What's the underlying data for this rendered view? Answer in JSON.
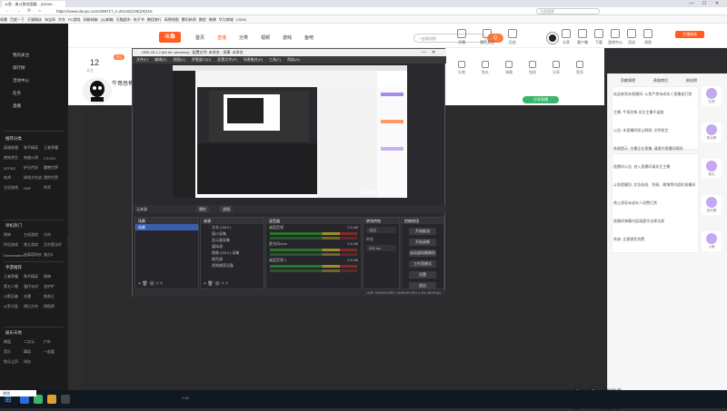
{
  "browser": {
    "tab_title": "斗鱼 - 来斗鱼的国服... [2D0M...",
    "url": "https://www.douyu.com/29871?_t=20142(226(29)116",
    "search_placeholder": "点此搜索",
    "bookmarks": [
      "收藏",
      "百度一下",
      "天猫精选",
      "淘宝网",
      "京东",
      "PC游戏",
      "网易邮箱",
      "QQ邮箱",
      "天猫超市",
      "电子书",
      "携程旅行",
      "高德地图",
      "腾讯新闻",
      "携程",
      "微博",
      "华为商城",
      "CSDN"
    ],
    "nav_back": "←",
    "nav_forward": "→",
    "nav_refresh": "⟳",
    "nav_home": "⌂",
    "win_min": "—",
    "win_max": "☐",
    "win_close": "✕"
  },
  "douyu_header": {
    "logo": "斗鱼",
    "nav": [
      "首页",
      "直播",
      "分类",
      "视频",
      "游戏",
      "鱼吧"
    ],
    "active_nav": "直播",
    "search_placeholder": "一起看电影",
    "search_button": "Q",
    "header_icons": [
      "开播",
      "我的关注",
      "历史",
      "分享",
      "客户端",
      "下载",
      "游戏中心",
      "活动",
      "消息"
    ],
    "vip_button": "开通贵族"
  },
  "sidebar": {
    "top_items": [
      "我的关注",
      "排行榜",
      "活动中心",
      "任务"
    ],
    "live_label": "直播",
    "section1_title": "推荐分类",
    "section1_items": [
      "英雄联盟",
      "和平精英",
      "王者荣耀",
      "绝地求生",
      "穿越火线",
      "CS:GO",
      "DOTA2",
      "炉石传说",
      "魔兽世界",
      "吃鸡",
      "球球大作战",
      "我的世界",
      "主机游戏",
      "DNF",
      "传奇"
    ],
    "section2_title": "单机热门",
    "section2_items": [
      "原神",
      "主机游戏",
      "方舟",
      "怀旧游戏",
      "独立游戏",
      "艾尔登法环",
      "Dreamcatcher",
      "逃离塔科夫",
      "鬼泣5"
    ],
    "section3_title": "手游推荐",
    "section3_items": [
      "王者荣耀",
      "和平精英",
      "原神",
      "第五人格",
      "蛋仔派对",
      "金铲铲",
      "火影忍者",
      "光遇",
      "航海王",
      "斗罗大陆",
      "明日方舟",
      "阴阳师"
    ],
    "section4_title": "娱乐天地",
    "section4_items": [
      "颜值",
      "二次元",
      "户外",
      "音乐",
      "舞蹈",
      "一起看",
      "鱼乐之声",
      "科技"
    ],
    "bottom_btn1": "开播",
    "bottom_btn2": "我的关注"
  },
  "streamer": {
    "follower_count": "12",
    "follower_label": "关注",
    "name": "牛哥恐怖",
    "share_button": "分享直播",
    "toolbar": [
      "礼物",
      "鱼丸",
      "弹幕",
      "钻粉",
      "分享",
      "更多",
      "客户端",
      "主播",
      "设置"
    ]
  },
  "obs": {
    "title": "OBS 28.1.2 (64-bit, windows) - 配置文件: 未命名 - 场景: 未命名",
    "menu": [
      "文件(F)",
      "编辑(E)",
      "视图(V)",
      "停靠窗口(D)",
      "配置文件(P)",
      "场景集合(S)",
      "工具(T)",
      "帮助(H)"
    ],
    "scene_label": "无来源",
    "props_button": "属性",
    "filter_button": "滤镜",
    "docks": {
      "scenes": {
        "title": "场景",
        "items": [
          "场景"
        ]
      },
      "sources": {
        "title": "来源",
        "items": [
          "文本 (GDI+)",
          "窗口采集",
          "显示器采集",
          "媒体源",
          "图像 (GDI+) 采集",
          "颜色源",
          "视频捕获设备"
        ]
      },
      "mixer": {
        "title": "混音器",
        "items": [
          "桌面音频",
          "麦克风/Aux",
          "桌面音频 2"
        ],
        "levels": [
          "0.0 dB",
          "0.0 dB",
          "0.0 dB"
        ]
      },
      "transitions": {
        "title": "转场特效",
        "type": "淡出",
        "duration_label": "时长",
        "duration": "300 ms"
      },
      "controls": {
        "title": "控制按钮",
        "buttons": [
          "开始推流",
          "开始录制",
          "启动虚拟摄像机",
          "工作室模式",
          "设置",
          "退出"
        ]
      }
    },
    "status": [
      "LIVE: 00:00:00",
      "REC: 00:00:00",
      "CPU: 1.3%, 60.00 fps"
    ]
  },
  "right_panel": {
    "tabs": [
      "贡献周榜",
      "贵族席位",
      "粉丝榜"
    ],
    "messages": [
      "欢迎来到本直播间, 斗鱼严禁未成年人直播或打赏",
      "主播: 牛哥恐怖 关注主播不迷路",
      "公告: 本直播间禁止刷屏, 文明发言",
      "系统提示: 主播正在直播, 请遵守直播间规则",
      "直播间公告: 进入直播间请关注主播",
      "斗鱼提醒您: 涉及低俗、色情、赌博等内容的直播间将被封禁",
      "禁止诱导未成年人消费打赏",
      "直播间弹幕内容请遵守法律法规",
      "系统: 注意理性消费"
    ],
    "gifts": [
      "礼物",
      "粉丝牌",
      "鱼丸",
      "荧光棒",
      "火箭"
    ]
  },
  "watermark": "水友群: 143238382",
  "taskbar": {
    "tray_text": "7:43",
    "float_label": "浏览"
  }
}
